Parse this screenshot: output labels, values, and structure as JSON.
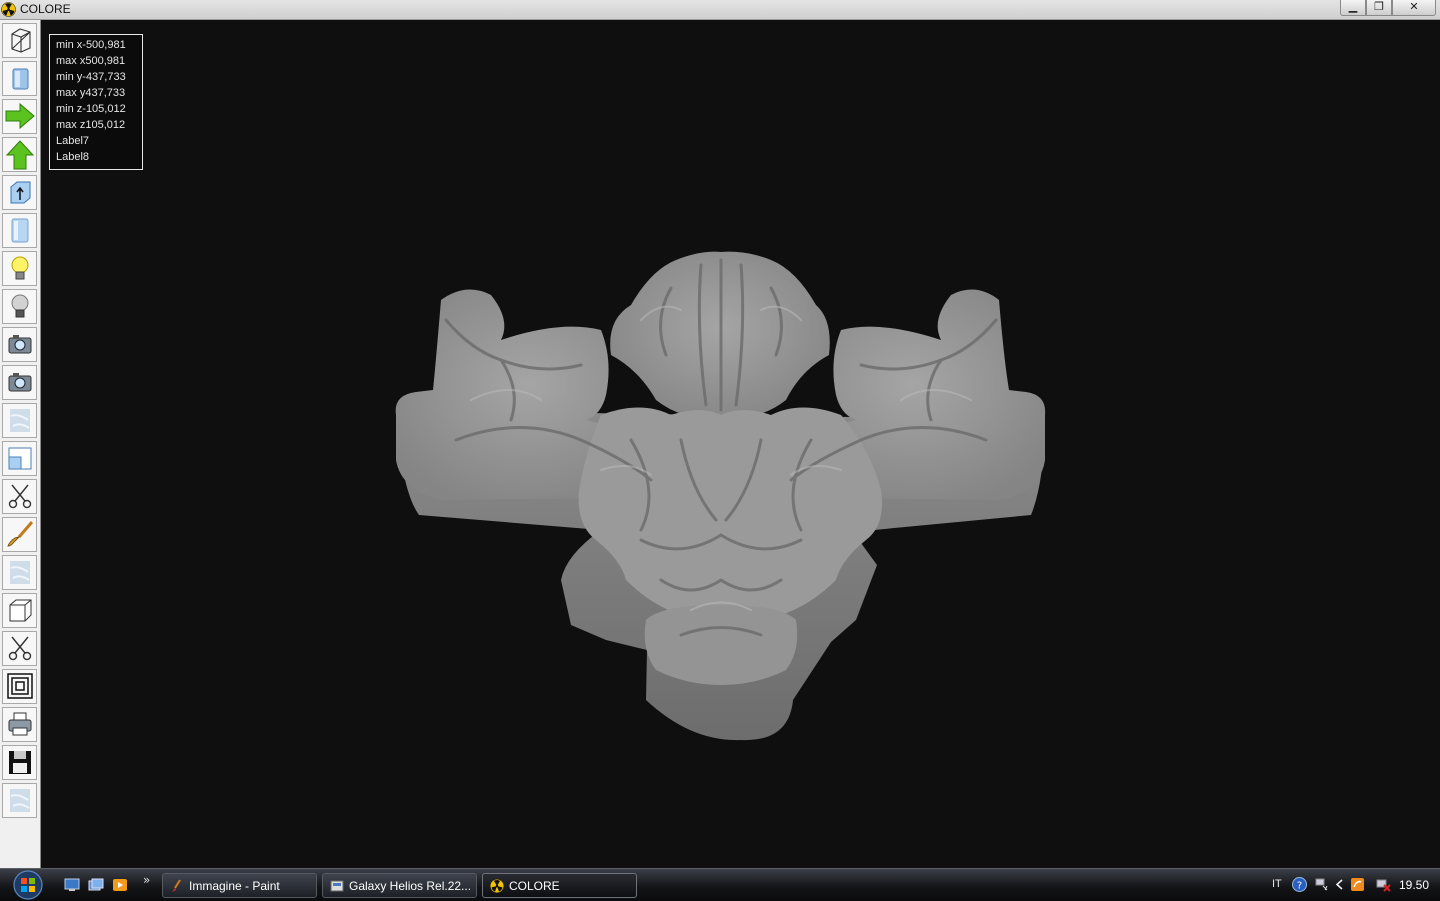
{
  "window": {
    "title": "COLORE",
    "buttons": {
      "minimize": "▁",
      "restore": "❐",
      "close": "✕"
    }
  },
  "toolbar": {
    "tools": [
      "wireframe-cube-icon",
      "solid-cube-icon",
      "arrow-right-icon",
      "arrow-up-icon",
      "extrude-up-icon",
      "cylinder-icon",
      "light-on-icon",
      "light-off-icon",
      "camera-icon",
      "camera-icon-2",
      "marble-texture-icon",
      "viewport-icon",
      "scissors-icon",
      "brush-icon",
      "marble-texture-icon-2",
      "box-icon",
      "scissors-icon-2",
      "concentric-squares-icon",
      "printer-icon",
      "floppy-disk-icon",
      "marble-texture-icon-3"
    ]
  },
  "info": {
    "lines": [
      "min x-500,981",
      "max x500,981",
      "min y-437,733",
      "max y437,733",
      "min z-105,012",
      "max z105,012",
      "Label7",
      "Label8"
    ]
  },
  "taskbar": {
    "tasks": [
      {
        "label": "Immagine - Paint",
        "icon": "paint-icon",
        "active": false
      },
      {
        "label": "Galaxy Helios  Rel.22...",
        "icon": "helios-icon",
        "active": false
      },
      {
        "label": "COLORE",
        "icon": "radiation-icon",
        "active": true
      }
    ],
    "quicklaunch_more": "»",
    "language": "IT",
    "clock": "19.50"
  },
  "colors": {
    "viewport_bg": "#0f0f0f",
    "model_gray": "#8f8f8f",
    "toolbar_bg": "#f0f0f0"
  }
}
